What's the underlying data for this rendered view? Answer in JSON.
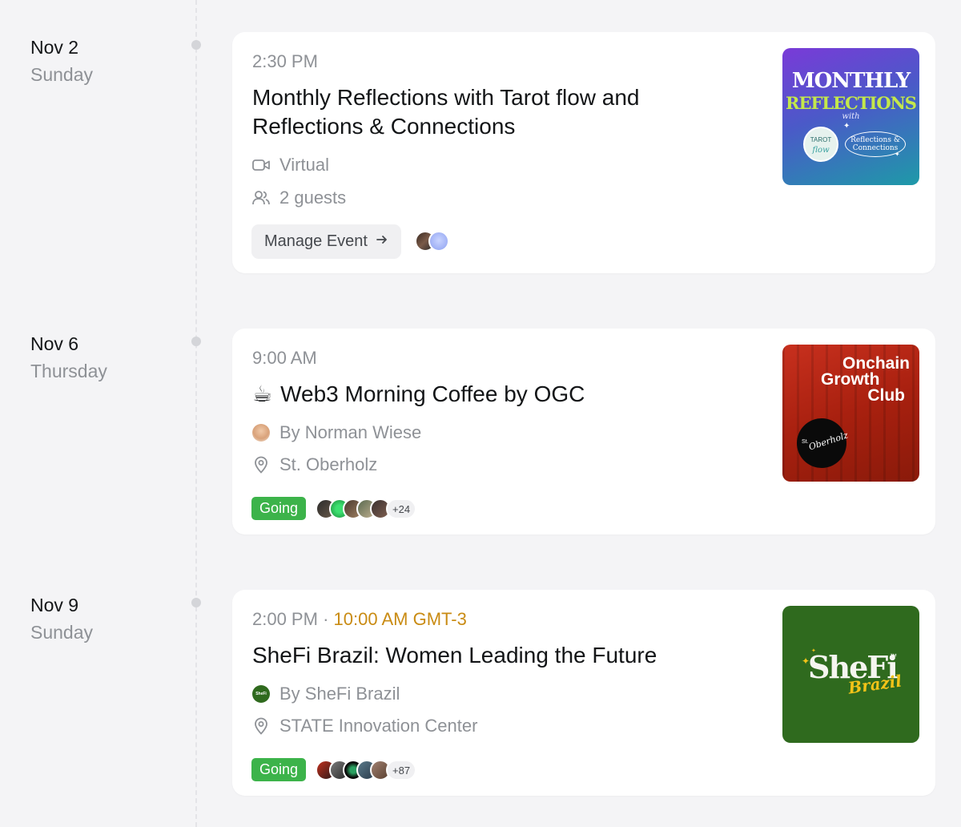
{
  "events": [
    {
      "date": "Nov 2",
      "weekday": "Sunday",
      "time": "2:30 PM",
      "title": "Monthly Reflections with Tarot flow and Reflections & Connections",
      "location": "Virtual",
      "guests": "2 guests",
      "button_label": "Manage Event",
      "thumb": {
        "line1": "MONTHLY",
        "line2": "REFLECTIONS",
        "line3": "with",
        "badge_left_top": "TAROT",
        "badge_left_bottom": "flow",
        "badge_right_top": "Reflections &",
        "badge_right_bottom": "Connections"
      }
    },
    {
      "date": "Nov 6",
      "weekday": "Thursday",
      "time": "9:00 AM",
      "title_emoji": "☕",
      "title": "Web3 Morning Coffee by OGC",
      "host": "By Norman Wiese",
      "location": "St. Oberholz",
      "status": "Going",
      "more_count": "+24",
      "thumb": {
        "line1": "Onchain",
        "line2": "Growth",
        "line3": "Club",
        "badge_small": "St.",
        "badge": "Oberholz"
      }
    },
    {
      "date": "Nov 9",
      "weekday": "Sunday",
      "time": "2:00 PM",
      "time_separator": "·",
      "local_time": "10:00 AM GMT-3",
      "title": "SheFi Brazil: Women Leading the Future",
      "host": "By SheFi Brazil",
      "host_avatar_text": "SheFi",
      "location": "STATE Innovation Center",
      "status": "Going",
      "more_count": "+87",
      "thumb": {
        "line1": "SheFi",
        "line2": "Brazil",
        "tm": "™"
      }
    }
  ],
  "colors": {
    "background": "#f4f4f6",
    "card": "#ffffff",
    "muted_text": "#8e9196",
    "going_green": "#3cb34a",
    "local_time_amber": "#c98b13"
  }
}
